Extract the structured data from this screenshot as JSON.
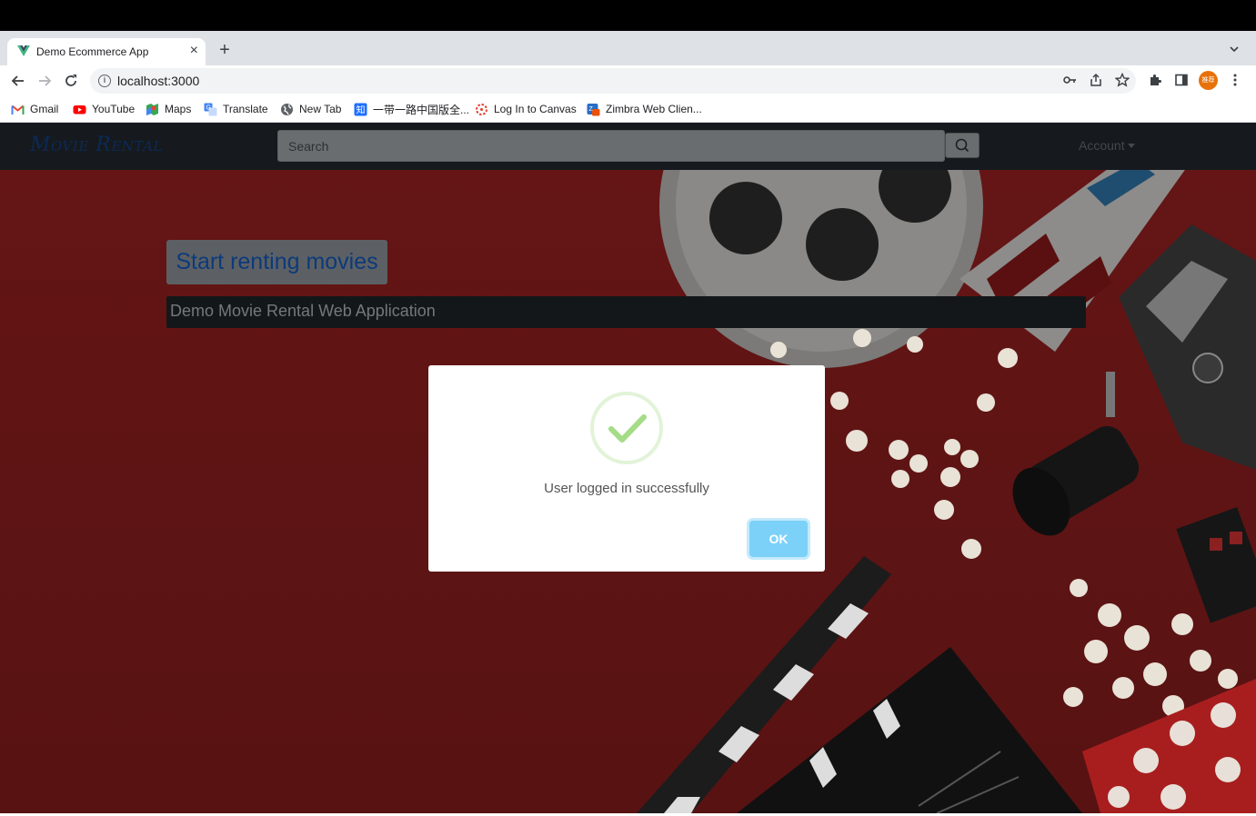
{
  "browser": {
    "tab_title": "Demo Ecommerce App",
    "url": "localhost:3000",
    "profile_text": "推荐"
  },
  "bookmarks": [
    {
      "label": "Gmail",
      "icon": "gmail-icon"
    },
    {
      "label": "YouTube",
      "icon": "youtube-icon"
    },
    {
      "label": "Maps",
      "icon": "maps-icon"
    },
    {
      "label": "Translate",
      "icon": "translate-icon"
    },
    {
      "label": "New Tab",
      "icon": "globe-icon"
    },
    {
      "label": "一带一路中国版全...",
      "icon": "zhihu-icon"
    },
    {
      "label": "Log In to Canvas",
      "icon": "canvas-icon"
    },
    {
      "label": "Zimbra Web Clien...",
      "icon": "zimbra-icon"
    }
  ],
  "navbar": {
    "brand": "Movie Rental",
    "search_placeholder": "Search",
    "account_label": "Account"
  },
  "hero": {
    "cta_label": "Start renting movies",
    "subtitle": "Demo Movie Rental Web Application"
  },
  "modal": {
    "message": "User logged in successfully",
    "ok_label": "OK"
  },
  "colors": {
    "modal_ok": "#7cd1f9",
    "success_check": "#a5dc86",
    "hero_background": "#651515"
  }
}
